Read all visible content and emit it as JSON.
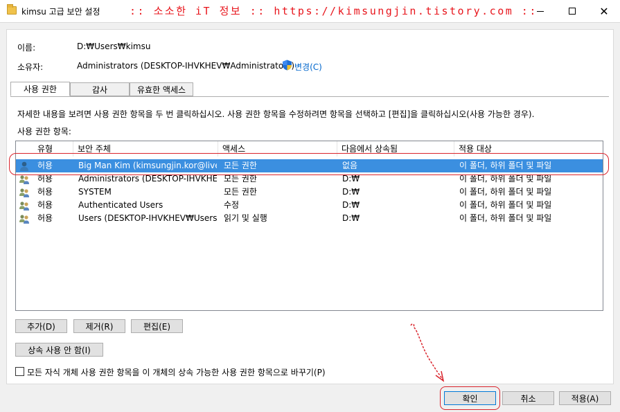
{
  "titlebar": {
    "title": "kimsu 고급 보안 설정",
    "banner": ":: 소소한 iT 정보 :: https://kimsungjin.tistory.com ::",
    "minimize_label": "",
    "close_label": "✕"
  },
  "info": {
    "name_label": "이름:",
    "name_value": "D:₩Users₩kimsu",
    "owner_label": "소유자:",
    "owner_value": "Administrators (DESKTOP-IHVKHEV₩Administrators)",
    "change_link": "변경(C)"
  },
  "tabs": [
    {
      "label": "사용 권한"
    },
    {
      "label": "감사"
    },
    {
      "label": "유효한 액세스"
    }
  ],
  "instructions": "자세한 내용을 보려면 사용 권한 항목을 두 번 클릭하십시오. 사용 권한 항목을 수정하려면 항목을 선택하고 [편집]을 클릭하십시오(사용 가능한 경우).",
  "list_label": "사용 권한 항목:",
  "columns": [
    "유형",
    "보안 주체",
    "액세스",
    "다음에서 상속됨",
    "적용 대상"
  ],
  "rows": [
    {
      "type": "허용",
      "principal": "Big Man Kim (kimsungjin.kor@live....",
      "access": "모든 권한",
      "inherited": "없음",
      "applies": "이 폴더, 하위 폴더 및 파일",
      "icon": "single-user-icon"
    },
    {
      "type": "허용",
      "principal": "Administrators (DESKTOP-IHVKHE...",
      "access": "모든 권한",
      "inherited": "D:₩",
      "applies": "이 폴더, 하위 폴더 및 파일",
      "icon": "group-user-icon"
    },
    {
      "type": "허용",
      "principal": "SYSTEM",
      "access": "모든 권한",
      "inherited": "D:₩",
      "applies": "이 폴더, 하위 폴더 및 파일",
      "icon": "group-user-icon"
    },
    {
      "type": "허용",
      "principal": "Authenticated Users",
      "access": "수정",
      "inherited": "D:₩",
      "applies": "이 폴더, 하위 폴더 및 파일",
      "icon": "group-user-icon"
    },
    {
      "type": "허용",
      "principal": "Users (DESKTOP-IHVKHEV₩Users)",
      "access": "읽기 및 실행",
      "inherited": "D:₩",
      "applies": "이 폴더, 하위 폴더 및 파일",
      "icon": "group-user-icon"
    }
  ],
  "buttons": {
    "add": "추가(D)",
    "remove": "제거(R)",
    "edit": "편집(E)",
    "disable_inheritance": "상속 사용 안 함(I)",
    "ok": "확인",
    "cancel": "취소",
    "apply": "적용(A)"
  },
  "replace_checkbox": "모든 자식 개체 사용 권한 항목을 이 개체의 상속 가능한 사용 권한 항목으로 바꾸기(P)",
  "colors": {
    "selected_row": "#3b8fe0",
    "annotation_red": "#d9232b",
    "link_blue": "#0066cc"
  }
}
